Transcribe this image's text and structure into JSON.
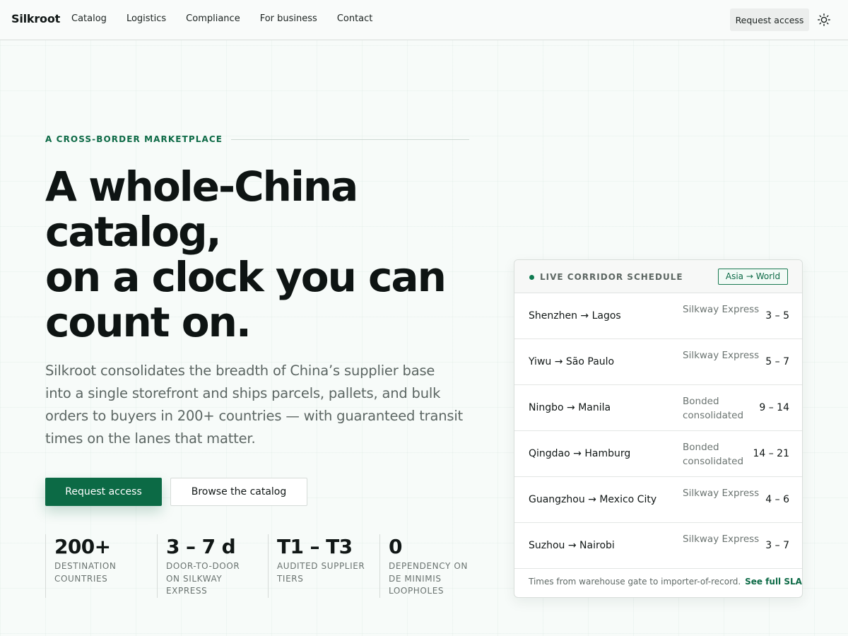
{
  "header": {
    "brand": "Silkroot",
    "nav": [
      "Catalog",
      "Logistics",
      "Compliance",
      "For business",
      "Contact"
    ],
    "cta": "Request access",
    "theme_toggle_icon": "sun-icon"
  },
  "hero": {
    "eyebrow": "A CROSS-BORDER MARKETPLACE",
    "headline": [
      "A whole-China",
      "catalog,",
      "on a clock you can",
      "count on."
    ],
    "lede": [
      "Silkroot consolidates the breadth of China’s supplier base",
      "into a single storefront and ships parcels, pallets, and bulk",
      "orders to buyers in 200+ countries — with guaranteed transit",
      "times on the lanes that matter."
    ],
    "primary_cta": "Request access",
    "secondary_cta": "Browse the catalog",
    "stats": [
      {
        "value": "200+",
        "label": "DESTINATION COUNTRIES"
      },
      {
        "value": "3 – 7 d",
        "label": "DOOR-TO-DOOR ON SILKWAY EXPRESS"
      },
      {
        "value": "T1 – T3",
        "label": "AUDITED SUPPLIER TIERS"
      },
      {
        "value": "0",
        "label": "DEPENDENCY ON DE MINIMIS LOOPHOLES"
      }
    ]
  },
  "schedule": {
    "title": "LIVE CORRIDOR SCHEDULE",
    "tag": "Asia → World",
    "rows": [
      {
        "route": "Shenzhen → Lagos",
        "carrier": "Silkway Express",
        "days": "3 – 5"
      },
      {
        "route": "Yiwu → São Paulo",
        "carrier": "Silkway Express",
        "days": "5 – 7"
      },
      {
        "route": "Ningbo → Manila",
        "carrier": "Bonded consolidated",
        "days": "9 – 14"
      },
      {
        "route": "Qingdao → Hamburg",
        "carrier": "Bonded consolidated",
        "days": "14 – 21"
      },
      {
        "route": "Guangzhou → Mexico City",
        "carrier": "Silkway Express",
        "days": "4 – 6"
      },
      {
        "route": "Suzhou → Nairobi",
        "carrier": "Silkway Express",
        "days": "3 – 7"
      }
    ],
    "footnote": "Times from warehouse gate to importer-of-record.",
    "footnote_link": "See full SLA →"
  },
  "colors": {
    "accent": "#0c6a45",
    "background": "#f7fbf9",
    "text": "#111716",
    "muted": "#5c6663"
  }
}
